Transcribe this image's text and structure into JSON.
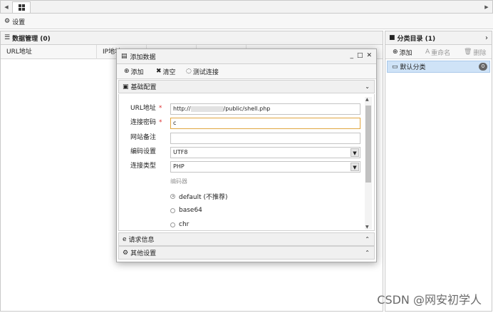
{
  "top_toolbar": {
    "settings_label": "设置"
  },
  "data_panel": {
    "title": "数据管理 (0)",
    "columns": [
      "URL地址",
      "IP地址"
    ]
  },
  "category_panel": {
    "title": "分类目录 (1)",
    "toolbar": {
      "add": "添加",
      "rename": "重命名",
      "delete": "删除"
    },
    "items": [
      {
        "name": "默认分类",
        "count": "0"
      }
    ]
  },
  "modal": {
    "title": "添加数据",
    "toolbar": {
      "add": "添加",
      "clear": "清空",
      "test": "测试连接"
    },
    "sections": {
      "basic": "基础配置",
      "request": "请求信息",
      "other": "其他设置"
    },
    "form": {
      "url_label": "URL地址",
      "url_prefix": "http://",
      "url_suffix": "/public/shell.php",
      "password_label": "连接密码",
      "password_value": "c",
      "note_label": "网站备注",
      "note_value": "",
      "encoding_label": "编码设置",
      "encoding_value": "UTF8",
      "type_label": "连接类型",
      "type_value": "PHP",
      "encoder_label": "编码器",
      "encoders": [
        "default (不推荐)",
        "base64",
        "chr"
      ]
    }
  },
  "watermark": "CSDN @网安初学人"
}
